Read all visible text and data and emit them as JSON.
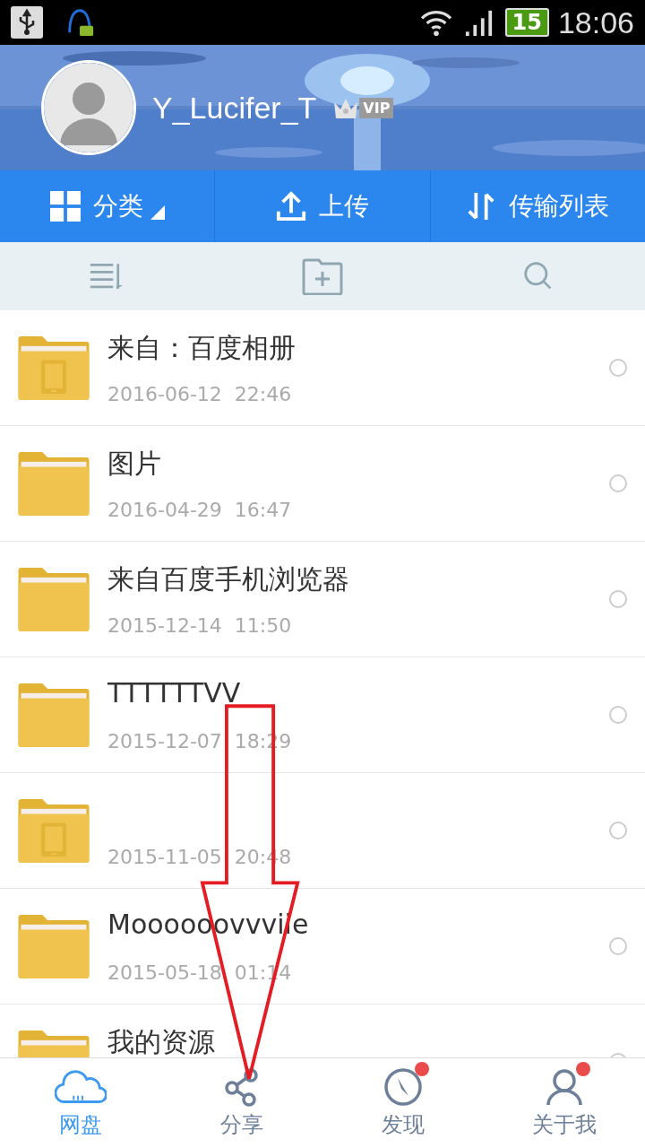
{
  "status_bar": {
    "battery": "15",
    "time": "18:06"
  },
  "profile": {
    "username": "Y_Lucifer_T",
    "vip_label": "VIP"
  },
  "actions": [
    {
      "kind": "category",
      "label": "分类"
    },
    {
      "kind": "upload",
      "label": "上传"
    },
    {
      "kind": "transfer",
      "label": "传输列表"
    }
  ],
  "files": [
    {
      "kind": "device",
      "name": "来自：百度相册",
      "date": "2016-06-12  22:46",
      "selected": false
    },
    {
      "kind": "plain",
      "name": "图片",
      "date": "2016-04-29  16:47",
      "selected": false
    },
    {
      "kind": "plain",
      "name": "来自百度手机浏览器",
      "date": "2015-12-14  11:50",
      "selected": false
    },
    {
      "kind": "plain",
      "name": "TTTTTTVV",
      "date": "2015-12-07  18:29",
      "selected": false
    },
    {
      "kind": "device",
      "date": "2015-11-05  20:48",
      "selected": false
    },
    {
      "kind": "plain",
      "name": "Moooooovvviie",
      "date": "2015-05-18  01:14",
      "selected": false
    },
    {
      "kind": "plain",
      "name": "我的资源",
      "selected": false
    }
  ],
  "tabs": [
    {
      "kind": "cloud",
      "label": "网盘",
      "selected": true,
      "badge": false
    },
    {
      "kind": "share",
      "label": "分享",
      "selected": false,
      "badge": false
    },
    {
      "kind": "compass",
      "label": "发现",
      "selected": false,
      "badge": true
    },
    {
      "kind": "person",
      "label": "关于我",
      "selected": false,
      "badge": true
    }
  ]
}
